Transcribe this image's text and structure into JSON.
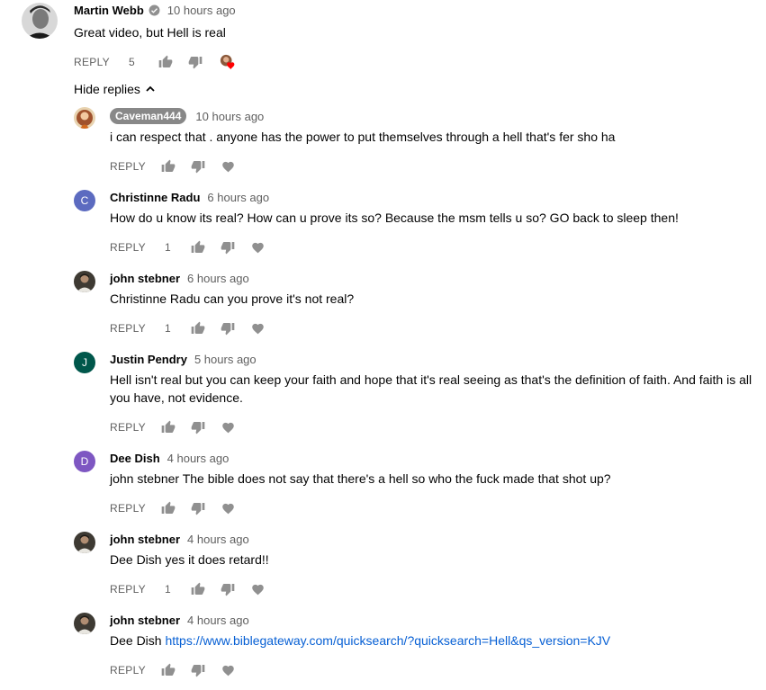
{
  "top_comment": {
    "author": "Martin Webb",
    "time": "10 hours ago",
    "text": "Great video, but Hell is real",
    "reply_label": "REPLY",
    "likes": "5"
  },
  "hide_replies_label": "Hide replies",
  "replies": [
    {
      "author": "Caveman444",
      "time": "10 hours ago",
      "text": "i can respect that . anyone has the power to put themselves through a hell that's fer sho ha",
      "reply_label": "REPLY",
      "likes": ""
    },
    {
      "author": "Christinne Radu",
      "avatar_letter": "C",
      "avatar_color": "#5c6bc0",
      "time": "6 hours ago",
      "text": "How do u know its real? How can u prove its so? Because the msm tells u so? GO back to sleep then!",
      "reply_label": "REPLY",
      "likes": "1"
    },
    {
      "author": "john stebner",
      "time": "6 hours ago",
      "text": "Christinne Radu can you prove it's not real?",
      "reply_label": "REPLY",
      "likes": "1"
    },
    {
      "author": "Justin Pendry",
      "avatar_letter": "J",
      "avatar_color": "#00574b",
      "time": "5 hours ago",
      "text_line1": "Hell isn't real but you can keep your faith and hope that it's real seeing as that's the definition of faith.  And faith is all",
      "text_line2": "you have, not evidence.",
      "reply_label": "REPLY",
      "likes": ""
    },
    {
      "author": "Dee Dish",
      "avatar_letter": "D",
      "avatar_color": "#7e57c2",
      "time": "4 hours ago",
      "text": "john stebner The bible does not say that there's a hell so who the fuck made that shot up?",
      "reply_label": "REPLY",
      "likes": ""
    },
    {
      "author": "john stebner",
      "time": "4 hours ago",
      "text": "Dee Dish yes it does retard!!",
      "reply_label": "REPLY",
      "likes": "1"
    },
    {
      "author": "john stebner",
      "time": "4 hours ago",
      "text_prefix": "Dee Dish ",
      "link": "https://www.biblegateway.com/quicksearch/?quicksearch=Hell&qs_version=KJV",
      "reply_label": "REPLY",
      "likes": ""
    }
  ],
  "colors": {
    "link": "#065fd4",
    "secondary": "#606060",
    "primary": "#030303",
    "heart": "#ff0000"
  },
  "icons": [
    "verified-icon",
    "thumb-up-icon",
    "thumb-down-icon",
    "heart-icon",
    "creator-heart-icon",
    "chevron-up-icon"
  ]
}
